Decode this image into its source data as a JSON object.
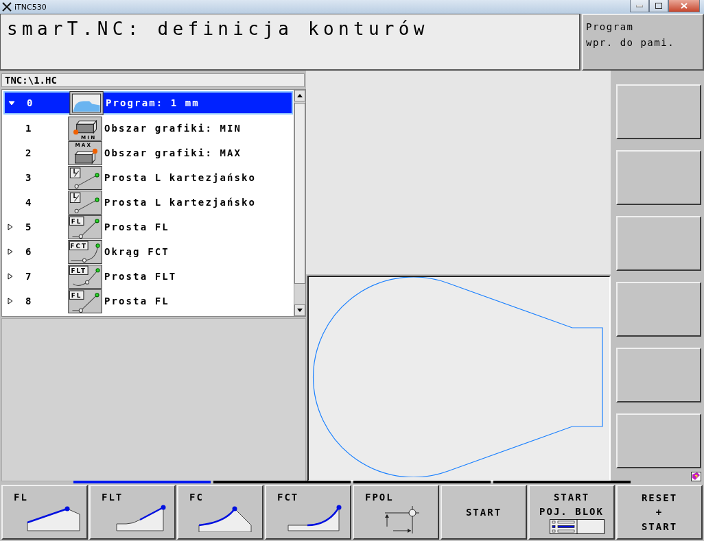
{
  "window": {
    "title": "iTNC530"
  },
  "header": {
    "title": "smarT.NC: definicja konturów",
    "mode_lines": [
      "Program",
      "wpr. do pami."
    ]
  },
  "path": "TNC:\\1.HC",
  "tree": {
    "rows": [
      {
        "number": "0",
        "label": "Program: 1 mm",
        "kind": "program",
        "expanded": true,
        "selected": true
      },
      {
        "number": "1",
        "label": "Obszar grafiki: MIN",
        "kind": "min",
        "icon_label": "MIN",
        "selected": false
      },
      {
        "number": "2",
        "label": "Obszar grafiki: MAX",
        "kind": "max",
        "icon_label": "MAX",
        "selected": false
      },
      {
        "number": "3",
        "label": "Prosta L kartezjańsko",
        "kind": "line-l",
        "icon_label": "L",
        "selected": false
      },
      {
        "number": "4",
        "label": "Prosta L kartezjańsko",
        "kind": "line-l",
        "icon_label": "L",
        "selected": false
      },
      {
        "number": "5",
        "label": "Prosta FL",
        "kind": "fl",
        "icon_label": "FL",
        "expanded": false,
        "selected": false
      },
      {
        "number": "6",
        "label": "Okrąg FCT",
        "kind": "fct",
        "icon_label": "FCT",
        "expanded": false,
        "selected": false
      },
      {
        "number": "7",
        "label": "Prosta FLT",
        "kind": "flt",
        "icon_label": "FLT",
        "expanded": false,
        "selected": false
      },
      {
        "number": "8",
        "label": "Prosta FL",
        "kind": "fl",
        "icon_label": "FL",
        "expanded": false,
        "selected": false
      }
    ]
  },
  "softkey_pages": [
    {
      "selected": true
    },
    {
      "selected": false
    },
    {
      "selected": false
    },
    {
      "selected": false
    }
  ],
  "softkeys": [
    {
      "kind": "fl",
      "lines": [
        "FL"
      ]
    },
    {
      "kind": "flt",
      "lines": [
        "FLT"
      ]
    },
    {
      "kind": "fc",
      "lines": [
        "FC"
      ]
    },
    {
      "kind": "fct",
      "lines": [
        "FCT"
      ]
    },
    {
      "kind": "fpol",
      "lines": [
        "FPOL"
      ]
    },
    {
      "kind": "text",
      "lines": [
        "START"
      ]
    },
    {
      "kind": "single-block",
      "lines": [
        "START",
        "POJ. BLOK"
      ]
    },
    {
      "kind": "text",
      "lines": [
        "RESET",
        "+",
        "START"
      ]
    }
  ]
}
